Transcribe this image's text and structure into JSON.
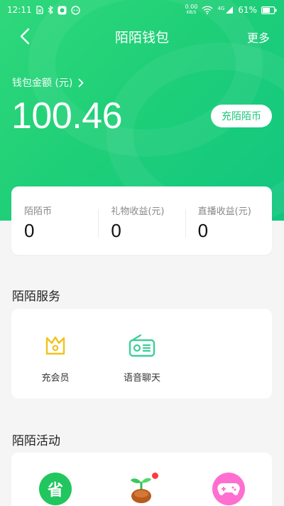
{
  "statusbar": {
    "time": "12:11",
    "net_speed_top": "0.00",
    "net_speed_bottom": "KB/S",
    "network": "4G",
    "battery": "61%"
  },
  "nav": {
    "title": "陌陌钱包",
    "more": "更多"
  },
  "wallet": {
    "label": "钱包金额 (元)",
    "balance": "100.46",
    "recharge": "充陌陌币"
  },
  "stats": [
    {
      "label": "陌陌币",
      "value": "0"
    },
    {
      "label": "礼物收益(元)",
      "value": "0"
    },
    {
      "label": "直播收益(元)",
      "value": "0"
    }
  ],
  "services": {
    "title": "陌陌服务",
    "items": [
      {
        "label": "充会员",
        "icon": "crown-icon"
      },
      {
        "label": "语音聊天",
        "icon": "radio-icon"
      }
    ]
  },
  "activities": {
    "title": "陌陌活动",
    "items": [
      {
        "icon": "save-badge-icon",
        "glyph": "省"
      },
      {
        "icon": "sprout-icon"
      },
      {
        "icon": "gamepad-icon"
      }
    ]
  },
  "colors": {
    "brand_green": "#1fcf78",
    "accent_yellow": "#f2c21b",
    "activity_green": "#21c65e",
    "activity_pink": "#ff6fd0"
  }
}
